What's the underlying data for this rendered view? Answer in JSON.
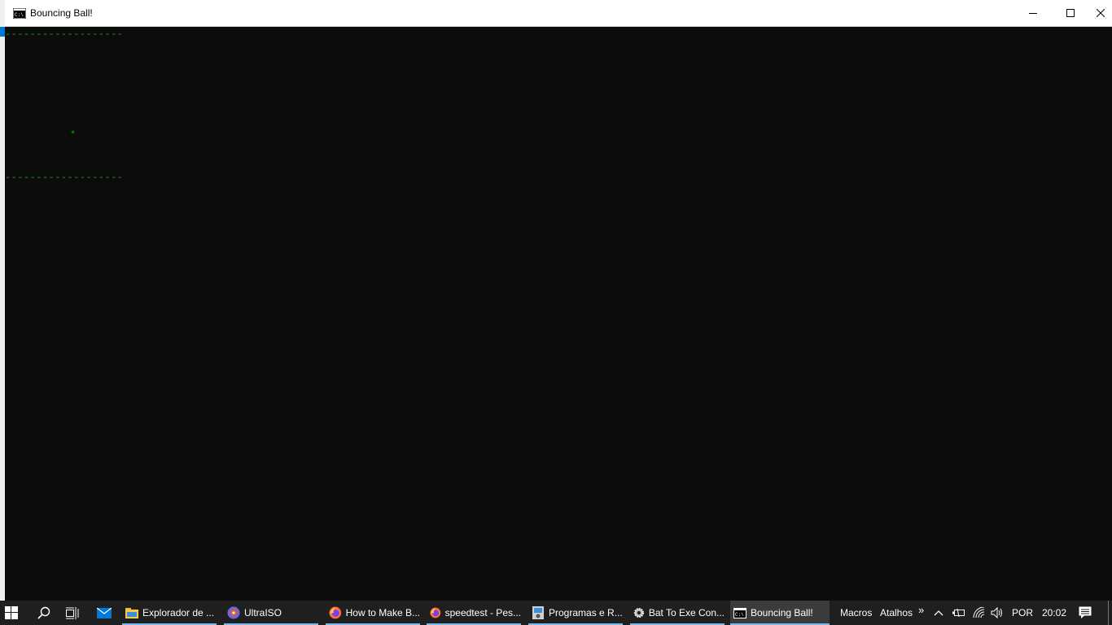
{
  "window": {
    "title": "Bouncing Ball!",
    "icon": "console-icon"
  },
  "console": {
    "top_border": "-------------------",
    "ball": "*",
    "bottom_border": "-------------------",
    "text_color": "#13a10e"
  },
  "taskbar": {
    "tasks": [
      {
        "label": "Explorador de ...",
        "icon": "folder-icon"
      },
      {
        "label": "UltraISO",
        "icon": "ultraiso-icon"
      },
      {
        "label": "How to Make B...",
        "icon": "firefox-icon"
      },
      {
        "label": "speedtest - Pes...",
        "icon": "firefox-icon"
      },
      {
        "label": "Programas e R...",
        "icon": "control-panel-icon"
      },
      {
        "label": "Bat To Exe Con...",
        "icon": "gear-icon"
      },
      {
        "label": "Bouncing Ball!",
        "icon": "console-icon",
        "active": true
      }
    ],
    "toolbars": [
      "Macros",
      "Atalhos"
    ],
    "overflow": "»",
    "language": "POR",
    "clock": "20:02"
  }
}
